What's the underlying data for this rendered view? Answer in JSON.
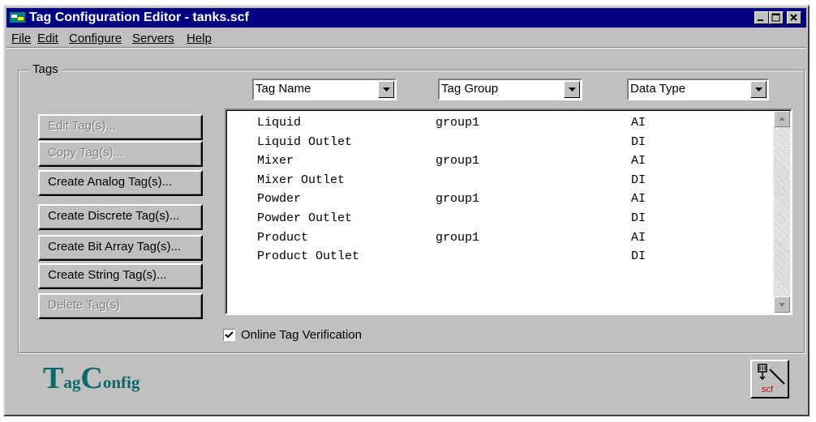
{
  "window": {
    "title": "Tag Configuration Editor - tanks.scf"
  },
  "menu": [
    "File",
    "Edit",
    "Configure",
    "Servers",
    "Help"
  ],
  "group": {
    "label": "Tags"
  },
  "columns": [
    {
      "label": "Tag Name"
    },
    {
      "label": "Tag Group"
    },
    {
      "label": "Data Type"
    }
  ],
  "buttons": {
    "edit": "Edit Tag(s)...",
    "copy": "Copy Tag(s)...",
    "create_analog": "Create Analog Tag(s)...",
    "create_discrete": "Create Discrete Tag(s)...",
    "create_bit_array": "Create Bit Array Tag(s)...",
    "create_string": "Create String Tag(s)...",
    "delete": "Delete Tag(s)"
  },
  "tags": [
    {
      "name": "Liquid",
      "group": "group1",
      "type": "AI"
    },
    {
      "name": "Liquid Outlet",
      "group": "",
      "type": "DI"
    },
    {
      "name": "Mixer",
      "group": "group1",
      "type": "AI"
    },
    {
      "name": "Mixer Outlet",
      "group": "",
      "type": "DI"
    },
    {
      "name": "Powder",
      "group": "group1",
      "type": "AI"
    },
    {
      "name": "Powder Outlet",
      "group": "",
      "type": "DI"
    },
    {
      "name": "Product",
      "group": "group1",
      "type": "AI"
    },
    {
      "name": "Product Outlet",
      "group": "",
      "type": "DI"
    }
  ],
  "verification": {
    "label": "Online Tag Verification",
    "checked": true
  },
  "logo": {
    "big1": "T",
    "small1": "ag",
    "big2": "C",
    "small2": "onfig"
  },
  "scf_button": {
    "text": "scf",
    "icon": "scf-file-icon"
  },
  "colors": {
    "titlebar": "#000080",
    "face": "#c0c0c0",
    "logo": "#0a6a6a",
    "scf": "#e00000"
  }
}
